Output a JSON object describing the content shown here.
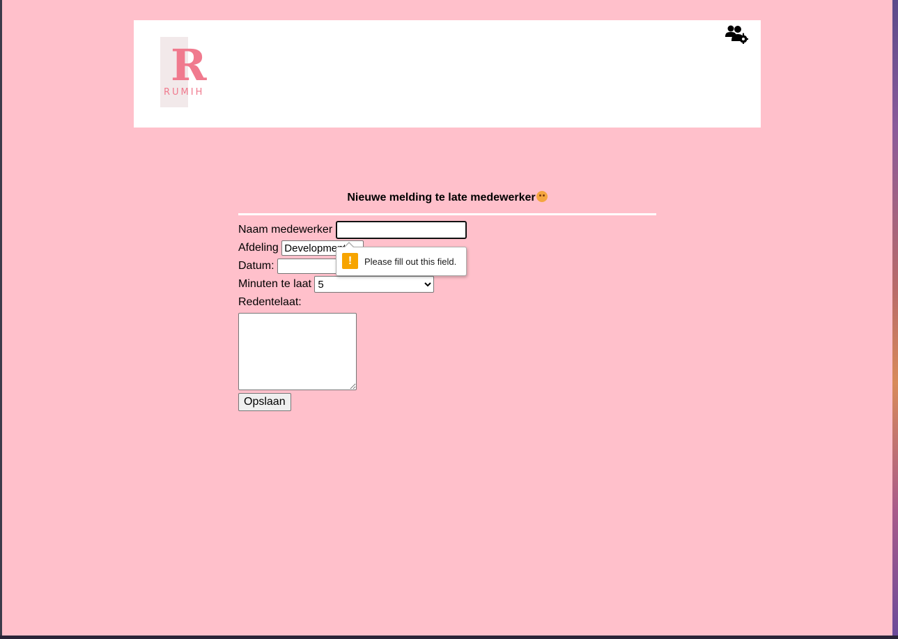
{
  "header": {
    "logo_letter": "R",
    "logo_word": "RUMIH",
    "admin_icon": "users-gear-icon"
  },
  "form": {
    "title": "Nieuwe melding te late medewerker",
    "title_emoji": "frowning-face-emoji",
    "fields": {
      "name_label": "Naam medewerker",
      "name_value": "",
      "department_label": "Afdeling",
      "department_value": "Development",
      "date_label": "Datum:",
      "date_value": "",
      "minutes_label": "Minuten te laat",
      "minutes_value": "5",
      "reason_label": "Redentelaat:",
      "reason_value": ""
    },
    "submit_label": "Opslaan"
  },
  "validation_tooltip": {
    "icon": "warning-icon",
    "message": "Please fill out this field."
  },
  "colors": {
    "page_background": "#ffc0cb",
    "header_background": "#ffffff",
    "logo_accent": "#f07a8e",
    "warning": "#f7a400"
  }
}
